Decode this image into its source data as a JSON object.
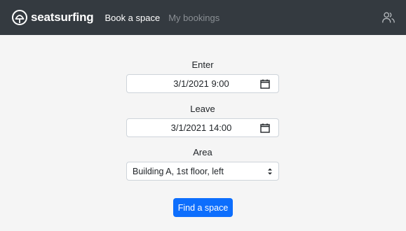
{
  "navbar": {
    "brand_name": "seatsurfing",
    "links": [
      {
        "label": "Book a space",
        "active": true
      },
      {
        "label": "My bookings",
        "active": false
      }
    ],
    "user_icon": "user-group-icon"
  },
  "form": {
    "enter_label": "Enter",
    "enter_value": "3/1/2021 9:00",
    "leave_label": "Leave",
    "leave_value": "3/1/2021 14:00",
    "area_label": "Area",
    "area_selected": "Building A, 1st floor, left",
    "submit_label": "Find a space"
  },
  "colors": {
    "navbar_bg": "#343a40",
    "page_bg": "#f5f5f5",
    "primary": "#0d6efd"
  }
}
